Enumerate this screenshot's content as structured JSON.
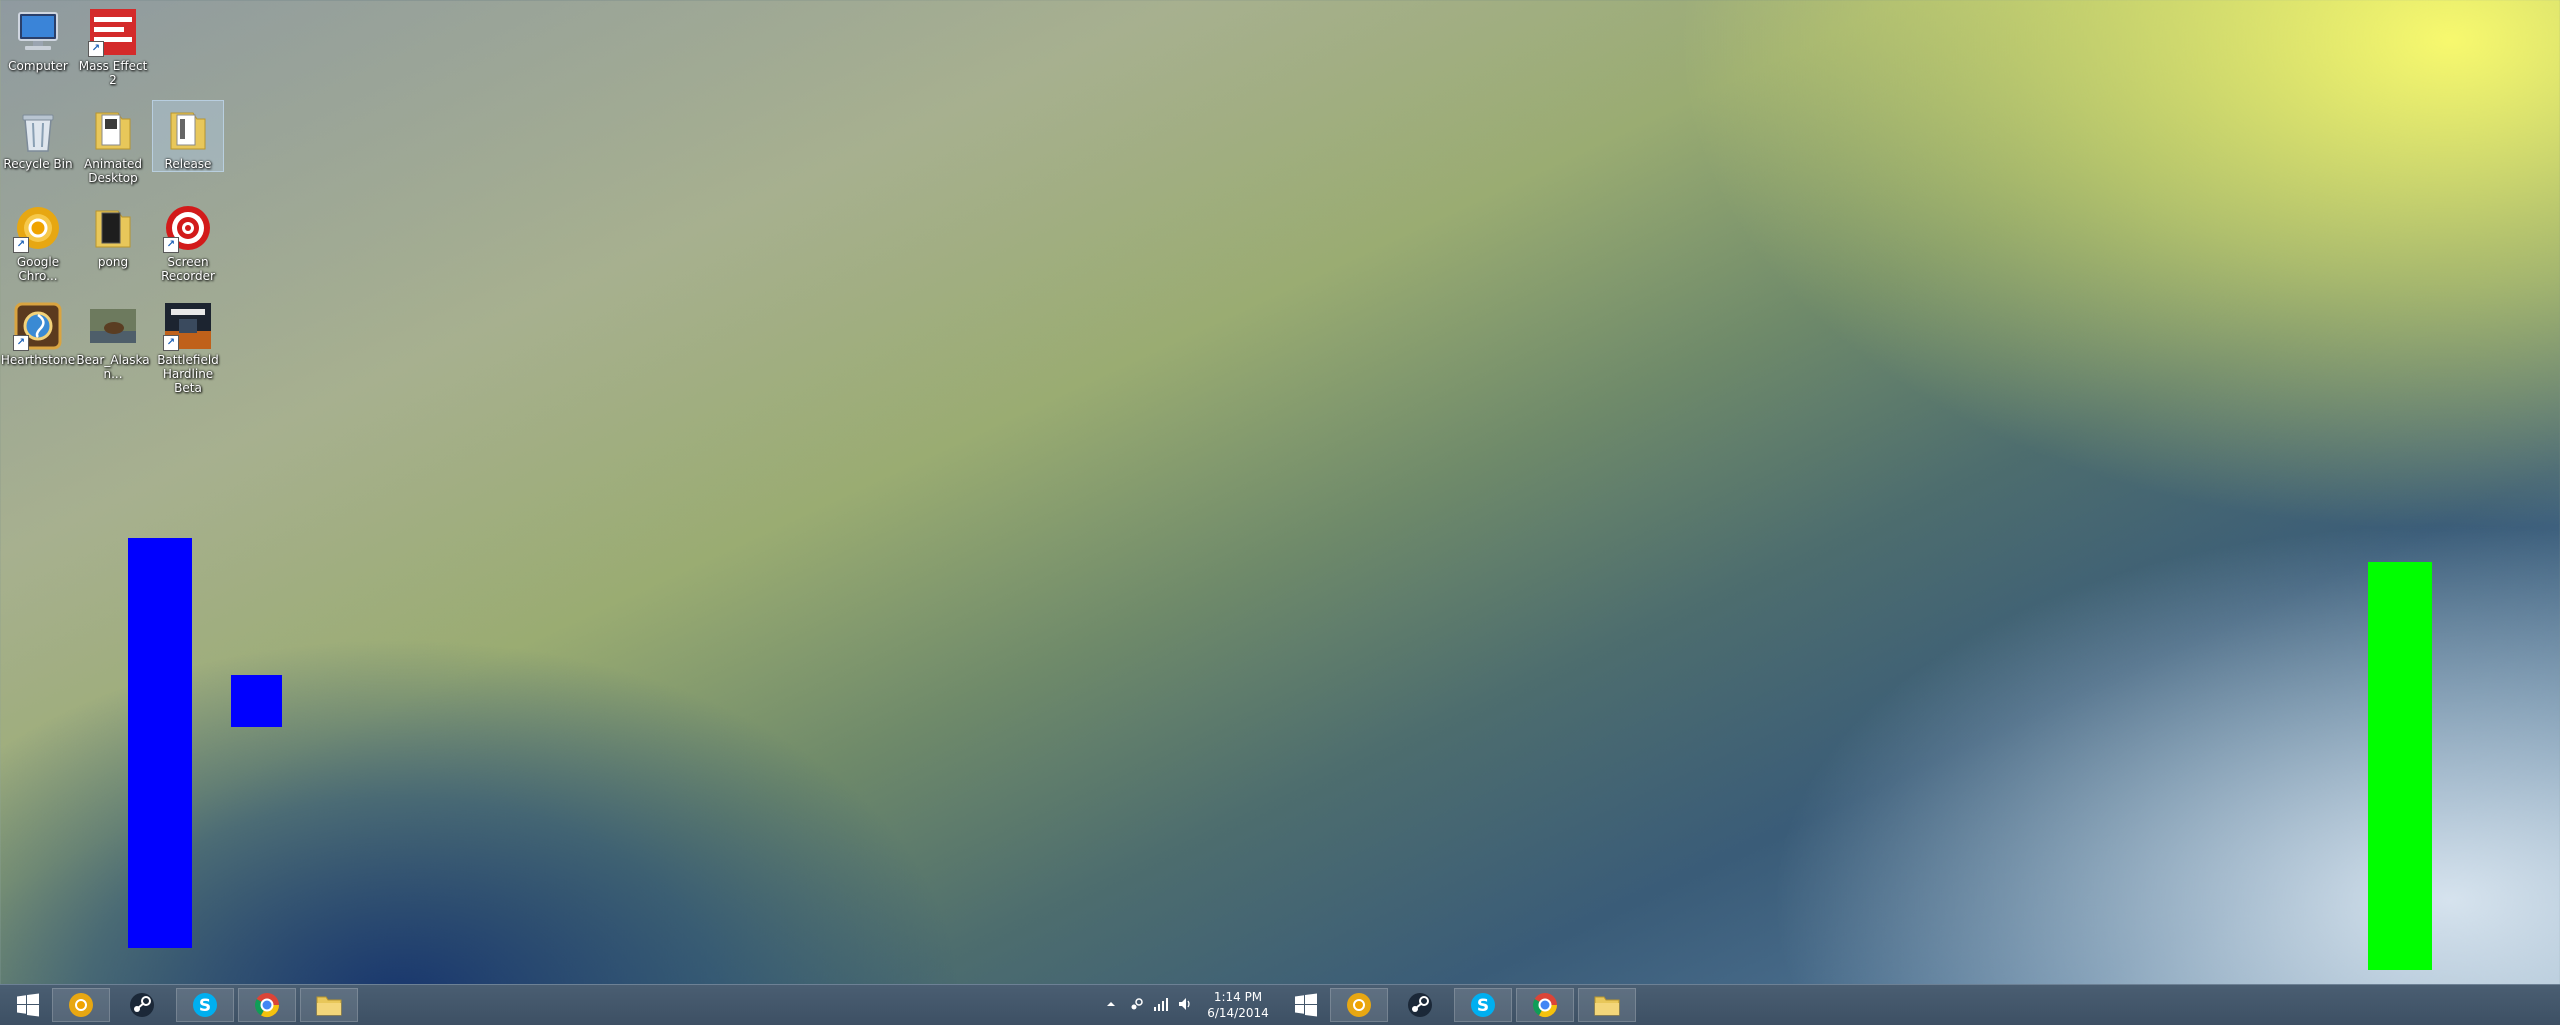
{
  "desktop_icons": [
    {
      "label": "Computer",
      "icon": "computer-icon"
    },
    {
      "label": "Mass Effect 2",
      "icon": "mass-effect-icon"
    },
    {
      "label": "Recycle Bin",
      "icon": "recycle-bin-icon"
    },
    {
      "label": "Animated Desktop",
      "icon": "folder-icon"
    },
    {
      "label": "Release",
      "icon": "folder-icon"
    },
    {
      "label": "Google Chro...",
      "icon": "chrome-canary-icon"
    },
    {
      "label": "pong",
      "icon": "folder-icon"
    },
    {
      "label": "Screen Recorder",
      "icon": "screen-recorder-icon"
    },
    {
      "label": "Hearthstone",
      "icon": "hearthstone-icon"
    },
    {
      "label": "Bear_Alaskan...",
      "icon": "image-thumbnail-icon"
    },
    {
      "label": "Battlefield Hardline Beta",
      "icon": "battlefield-icon"
    }
  ],
  "game": {
    "left_paddle_color": "#0000ff",
    "right_paddle_color": "#00ff00",
    "ball_color": "#0000ff"
  },
  "taskbar": {
    "left_apps": [
      "start-icon",
      "chrome-canary-icon",
      "steam-icon",
      "skype-icon",
      "chrome-icon",
      "file-explorer-icon"
    ],
    "tray": [
      "chevron-up-icon",
      "steam-tray-icon",
      "network-icon",
      "volume-icon"
    ],
    "clock": {
      "time": "1:14 PM",
      "date": "6/14/2014"
    },
    "right_apps": [
      "start-icon",
      "chrome-canary-icon",
      "steam-icon",
      "skype-icon",
      "chrome-icon",
      "file-explorer-icon"
    ]
  }
}
